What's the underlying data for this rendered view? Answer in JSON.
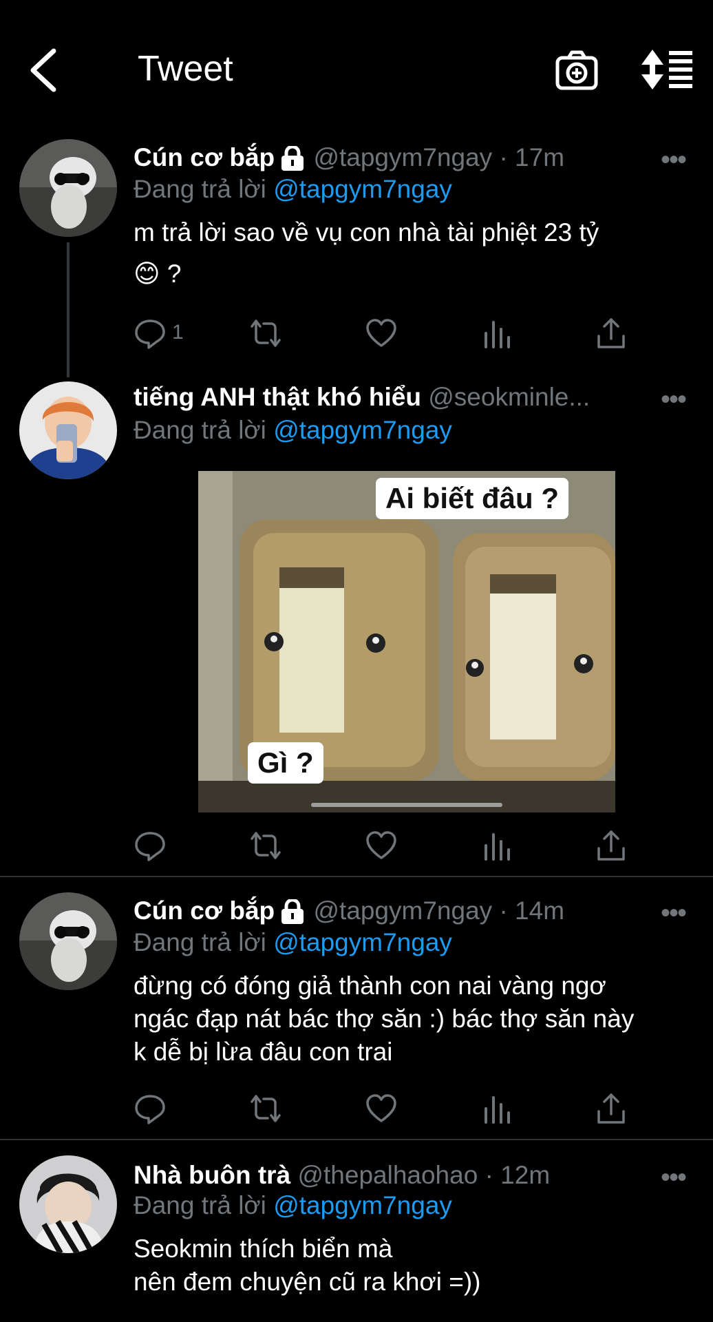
{
  "header": {
    "title": "Tweet"
  },
  "tweets": [
    {
      "name": "Cún cơ bắp",
      "handle": "@tapgym7ngay",
      "time": "· 17m",
      "reply_prefix": "Đang trả lời",
      "reply_to": "@tapgym7ngay",
      "text": "m trả lời sao về vụ con nhà tài phiệt 23 tỷ",
      "text2": "😊 ?",
      "reply_count": "1",
      "more": "•••"
    },
    {
      "name": "tiếng ANH thật khó hiểu",
      "handle": "@seokminle...",
      "reply_prefix": "Đang trả lời",
      "reply_to": "@tapgym7ngay",
      "media": {
        "caption_top": "Ai biết đâu ?",
        "caption_bottom": "Gì ?"
      },
      "more": "•••"
    },
    {
      "name": "Cún cơ bắp",
      "handle": "@tapgym7ngay",
      "time": "· 14m",
      "reply_prefix": "Đang trả lời",
      "reply_to": "@tapgym7ngay",
      "text_lines": [
        "đừng có đóng giả thành con nai vàng ngơ",
        "ngác đạp nát bác thợ săn :) bác thợ săn này",
        "k dễ bị lừa đâu con trai"
      ],
      "more": "•••"
    },
    {
      "name": "Nhà buôn trà",
      "handle": "@thepalhaohao",
      "time": "· 12m",
      "reply_prefix": "Đang trả lời",
      "reply_to": "@tapgym7ngay",
      "text_lines": [
        "Seokmin thích biển mà",
        "nên đem chuyện cũ ra khơi =))"
      ],
      "more": "•••"
    }
  ],
  "icons": [
    "back-arrow-icon",
    "camera-add-icon",
    "sort-icon",
    "lock-icon",
    "reply-icon",
    "retweet-icon",
    "like-icon",
    "views-icon",
    "share-icon"
  ],
  "colors": {
    "background": "#000000",
    "text": "#ffffff",
    "muted": "#71767b",
    "link": "#1d9bf0"
  }
}
